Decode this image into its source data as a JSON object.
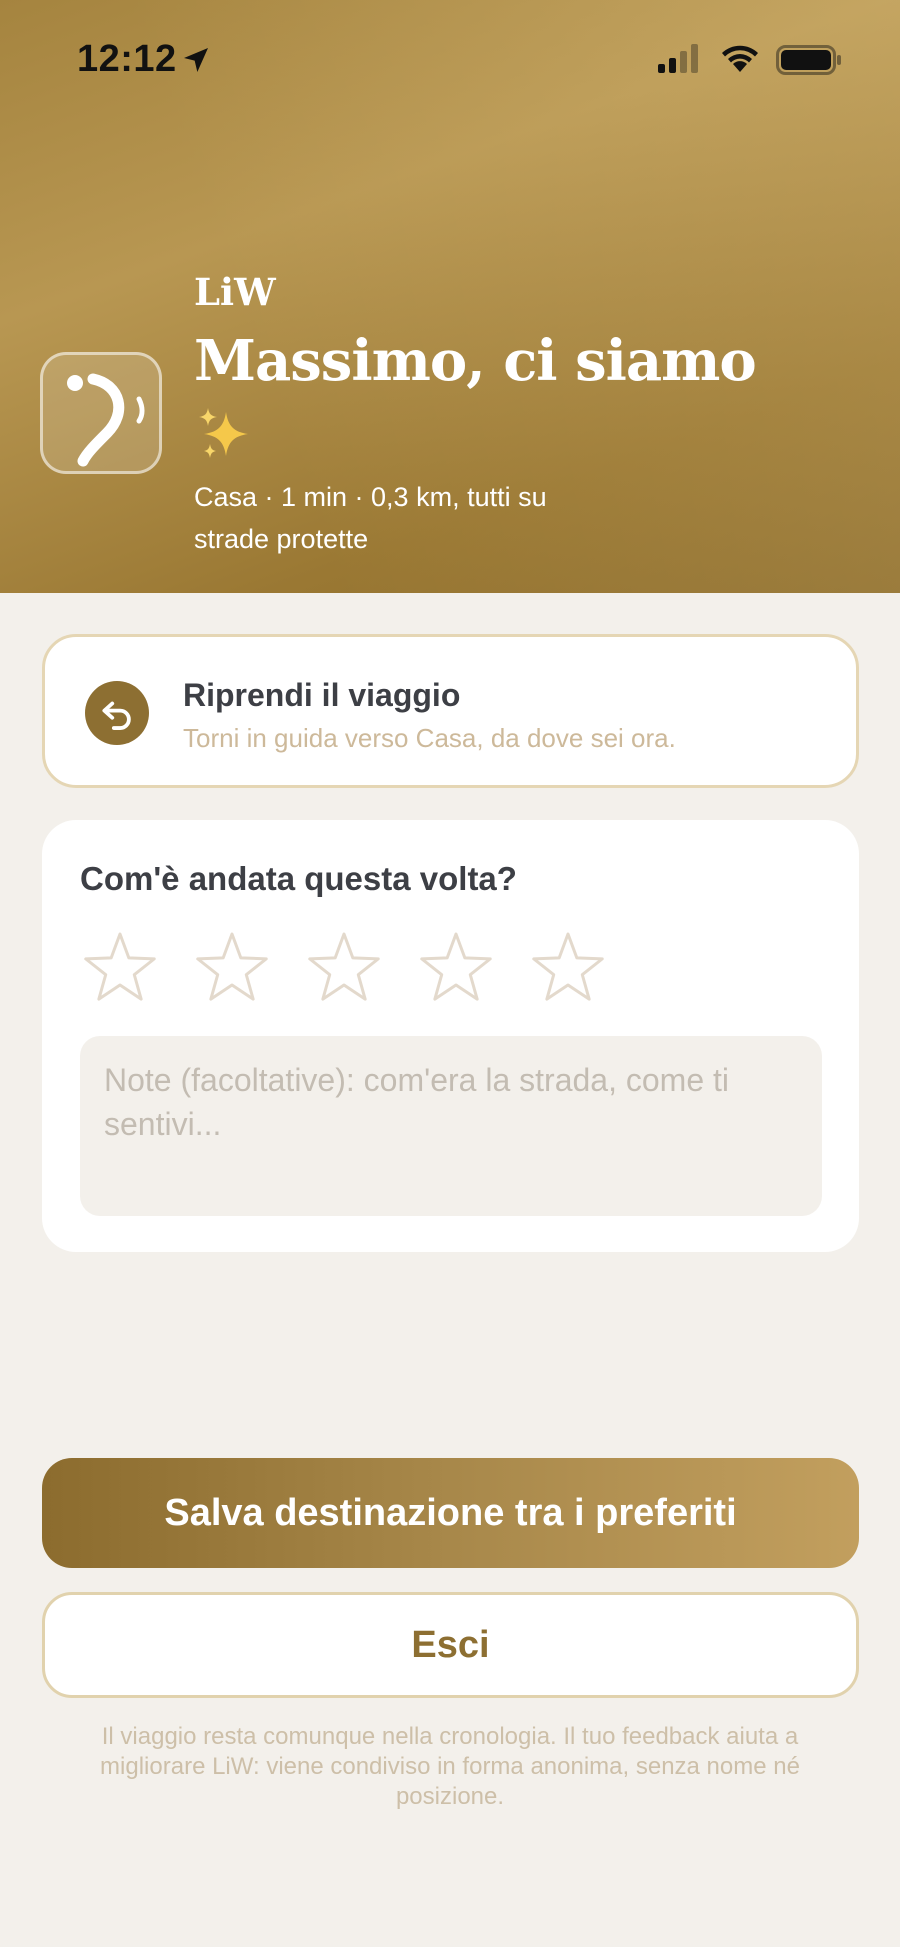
{
  "status_bar": {
    "time": "12:12",
    "icons": [
      "location-arrow-icon",
      "cellular-signal-icon",
      "wifi-icon",
      "battery-icon"
    ]
  },
  "header": {
    "brand": "LiW",
    "title": "Massimo, ci siamo",
    "emoji": "✨",
    "subtitle": "Casa · 1 min · 0,3 km, tutti su strade protette",
    "app_icon": "liw-logo-icon"
  },
  "resume": {
    "title": "Riprendi il viaggio",
    "subtitle": "Torni in guida verso Casa, da dove sei ora.",
    "icon": "undo-arrow-icon"
  },
  "rating": {
    "question": "Com'è andata questa volta?",
    "max_stars": 5,
    "selected_stars": 0,
    "notes_placeholder": "Note (facoltative): com'era la strada, come ti sentivi...",
    "notes_value": ""
  },
  "actions": {
    "save_label": "Salva destinazione tra i preferiti",
    "exit_label": "Esci"
  },
  "footnote": "Il viaggio resta comunque nella cronologia. Il tuo feedback aiuta a migliorare LiW: viene condiviso in forma anonima, senza nome né posizione.",
  "colors": {
    "accent": "#8d6f32",
    "header_gradient_light": "#c29f5e",
    "header_gradient_dark": "#8c6c2e",
    "background": "#f3f0eb",
    "text_dark": "#3d3f45",
    "muted": "#cdb99a"
  }
}
